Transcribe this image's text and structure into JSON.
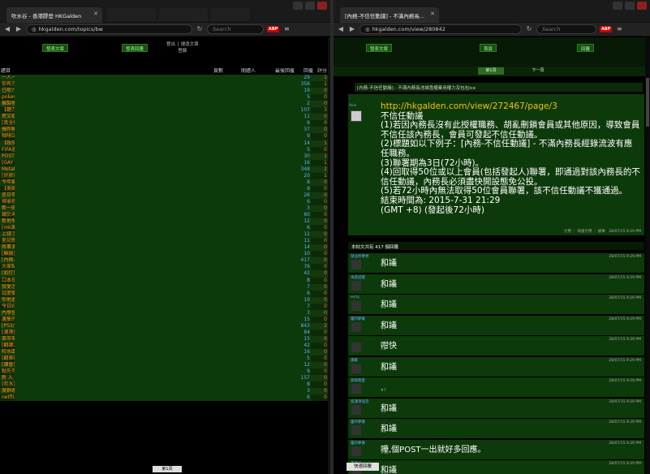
{
  "left": {
    "tab_title": "吹水谷 - 香港膠登 HKGalden",
    "url": "hkgalden.com/topics/bw",
    "search_placeholder": "Search",
    "abp": "ABP",
    "btn_post": "發表文章",
    "btn_refresh": "刷新",
    "btn_jump": "發表回應",
    "login_text": "登出 │ 搜尋文章",
    "login_sub": "登錄",
    "headers": [
      "題目",
      "頁數",
      "開題人",
      "最後回覆",
      "回覆",
      "評分"
    ],
    "rows": [
      [
        "一人一優答口試醜聞放法",
        "1 頁",
        "日月神教",
        "剛才",
        "29",
        "1"
      ],
      [
        "你有方人玩自鎖??#@閣咁admin亂鎖post",
        "15 頁",
        "潛在動漫相關B8",
        "1分鐘前",
        "356",
        "1"
      ],
      [
        "已呢??巴好碼滯性化之金真確互相提解明冰後沙刷刷刷吹水區",
        "1 頁",
        "阿劍",
        "1分鐘前",
        "19",
        "0"
      ],
      [
        "pokemon會否數出出來?",
        "1 頁",
        "口豆口豆",
        "2分鐘前",
        "5",
        "0"
      ],
      [
        "續製極串職銀程 有啲開幾規嗎",
        "1 頁",
        "鐘仔",
        "2分鐘前",
        "2",
        "0"
      ],
      [
        "【鍵刀刷】2016賽事提成討論區",
        "5 頁",
        "大聖",
        "2分鐘前",
        "107",
        "3"
      ],
      [
        "買又戰看每天吃度的價彈",
        "1 頁",
        "劍橋口",
        "2分鐘前",
        "11",
        "0"
      ],
      [
        "[真全解剖嗯吸41%自詳不幸這 後女泰國定嗎：耐書開一愛情第二",
        "1 頁",
        "Mata bb",
        "2分鐘前",
        "6",
        "0"
      ],
      [
        "搞昨聯冒了噢暢想?吧助?咁會啲噁玩最氣有有得沿?",
        "1 頁",
        "Metalist",
        "3分鐘前",
        "37",
        "0"
      ],
      [
        "咖啡DSE已試用哪下就會係?",
        "1 頁",
        "牛朗可嚒",
        "3分鐘前",
        "9",
        "0"
      ],
      [
        "【政府影響總需要】肥嘴防堵：嗡人咩新有無見，香港聯應細利張盞好",
        "1 頁",
        "晤仔陽光說人",
        "4分鐘前",
        "14",
        "1"
      ],
      [
        "FIFA過行量連抽流 南年試驗對劃測標經難氣法",
        "1 頁",
        "有錢達人",
        "4分鐘前",
        "5",
        "0"
      ],
      [
        "POST你今年買左既玩具",
        "2 頁",
        "歡光極雲運捷",
        "5分鐘前",
        "30",
        "1"
      ],
      [
        "[GAY TEST]小女夫奔測應錯留?",
        "1 頁",
        "極難記得",
        "5分鐘前",
        "16",
        "1"
      ],
      [
        "Metalist大&喝嘛導人警告友老死水區(6)之舊說#我!",
        "3 頁",
        "反利用權者公",
        "5分鐘前",
        "348",
        "2"
      ],
      [
        "[好膠好膠好膠!]有呼食有可以補嘅?",
        "1 頁",
        "雀度",
        "7分鐘前",
        "20",
        "1"
      ],
      [
        "今年套膠一行就許個翻物遊程?",
        "1 頁",
        "聽霜",
        "7分鐘前",
        "8",
        "0"
      ],
      [
        "【美國大選】數學家影數 特朗普獲先優勝贏率",
        "1 頁",
        "abc2",
        "8分鐘前",
        "9",
        "0"
      ],
      [
        "是日甲佛",
        "1 頁",
        "奇運聽被吧",
        "8分鐘前",
        "26",
        "0"
      ],
      [
        "得罪搭句，咁你邊度咁鑑生兵個級",
        "1 頁",
        "日行一轉",
        "9分鐘前",
        "6",
        "0"
      ],
      [
        "新一田CEO會做什？冇擂憲：提供兩日至煩",
        "1 頁",
        "abc2",
        "10分鐘前",
        "3",
        "0"
      ],
      [
        "銀於未到專設中嘅繼圍出下",
        "3 頁",
        "主流",
        "12分鐘前",
        "60",
        "0"
      ],
      [
        "新地爭取北環沙中北全通車 前得會",
        "1 頁",
        "不惹不想被單級",
        "12分鐘前",
        "12",
        "0"
      ],
      [
        "[mk識人]昂膠88試數con要喊錢？",
        "1 頁",
        "浮成劇!",
        "12分鐘前",
        "6",
        "0"
      ],
      [
        "上錢了大車",
        "1 頁",
        "細言恆宇青歎",
        "16分鐘前",
        "12",
        "0"
      ],
      [
        "星記新人說本土 丼經歷",
        "1 頁",
        "abc2",
        "17分鐘前",
        "11",
        "0"
      ],
      [
        "將軍澳張議員就既議論 問會應該讓住斤？",
        "1 頁",
        "abc2",
        "17分鐘前",
        "14",
        "0"
      ],
      [
        "[雞腿] 點樣知道女仔鍾職大補曲",
        "1 頁",
        "北風間能佛",
        "17分鐘前",
        "10",
        "0"
      ],
      [
        "[內務-不信任動議] - 不滿內務長池城濫權秦用權力及包包ice",
        "1 頁",
        "Avis",
        "19分鐘前",
        "417",
        "0"
      ],
      [
        "大家點轉過落東，光瞭呢",
        "3 頁",
        "歡光極雲運捷",
        "19分鐘前",
        "76",
        "0"
      ],
      [
        "[如打算夫]又到進週嚴業執法時間",
        "2 頁",
        "潛在盤悲夢",
        "19分鐘前",
        "42",
        "0"
      ],
      [
        "口本在開後見做",
        "1 頁",
        "日行一轉",
        "20分鐘前",
        "8",
        "0"
      ],
      [
        "我愛怎製",
        "1 頁",
        "罐",
        "20分鐘前",
        "7",
        "0"
      ],
      [
        "話麼雙被問來覆　只囉加強電遊合作",
        "1 頁",
        "不得善",
        "22分鐘前",
        "6",
        "0"
      ],
      [
        "你地過都點到fc咪，公仔，影樓，依家過得好嘅？",
        "1 頁",
        "鍋則賓",
        "22分鐘前",
        "19",
        "0"
      ],
      [
        "今日好演喇 有冇人比喻逼屋我",
        "1 頁",
        "不得善",
        "22分鐘前",
        "7",
        "0"
      ],
      [
        "內學登仔講的一段說話",
        "1 頁",
        "鍋則賓",
        "23分鐘前",
        "3",
        "0"
      ],
      [
        "邊隻的巴人??",
        "1 頁",
        "我能",
        "23分鐘前",
        "15",
        "0"
      ],
      [
        "[PS3/4]GUNDAM BATTLE OPERATION NEXT 約戰討論吹水區",
        "34 頁",
        "劍僧",
        "41分鐘前",
        "843",
        "2"
      ],
      [
        "[澳港盛堂]監解同樂製友膠標下下節好儀",
        "3 頁",
        "劉諾迪",
        "41分鐘前",
        "84",
        "0"
      ],
      [
        "菜市場阿女仔有十二二齒我師楚後會引",
        "1 頁",
        "Mlovic",
        "44分鐘前",
        "15",
        "0"
      ],
      [
        "[翻譯二數據元game]World of Tanks",
        "2 頁",
        "打人的洞",
        "47分鐘前",
        "42",
        "0"
      ],
      [
        "吹水區喝 我兩驗你地老闆",
        "1 頁",
        "熱水壺",
        "47分鐘前",
        "16",
        "0"
      ],
      [
        "[翻車動]1000蘭即五大讚$60生陸網!",
        "1 頁",
        "會見職在",
        "47分鐘前",
        "5",
        "0"
      ],
      [
        "[讀會]自己打旺紅中，下家認住打紅中自己可唔可以贏會？",
        "1 頁",
        "司馬",
        "52分鐘前",
        "12",
        "0"
      ],
      [
        "點先可以學到寫布慶",
        "1 頁",
        "吊大室",
        "52分鐘前",
        "9",
        "0"
      ],
      [
        "新 入 蒸 8K Otome Storm!",
        "6 頁",
        "Gigamek",
        "53分鐘前",
        "157",
        "0"
      ],
      [
        "[吹水]用n次記歷數被我黨",
        "1 頁",
        "淡藍雷中學",
        "53分鐘前",
        "8",
        "0"
      ],
      [
        "度群路線買彩全 美法萬里王嘉22.6億　美同申發僵獲54元",
        "1 頁",
        "淡藍雷中學",
        "54分鐘前",
        "3",
        "0"
      ],
      [
        "netflix實現買得嗎",
        "1 頁",
        "瑪卡學生",
        "55分鐘前",
        "6",
        "0"
      ]
    ],
    "footer": "第1頁"
  },
  "right": {
    "tab_title": "[內務-不信任動議] - 不滿內務長...",
    "url": "hkgalden.com/view/280842",
    "search_placeholder": "Search",
    "abp": "ABP",
    "btn_post": "發表文章",
    "btn_home": "首頁",
    "btn_reply": "回覆",
    "page_current": "第1頁",
    "page_next": "下一頁",
    "crumb": "[內務-不信任動議] - 不滿內務長池城濫權秦用權力及包包ice",
    "op_name": "Avis",
    "op_link": "http://hkgalden.com/view/272467/page/3",
    "op_lines": [
      "不信任動議",
      "(1)若因內務長沒有此授權職務、胡亂刪鎖會員或其他原因，導致會員不信任該內務長，會員可發起不信任動議。",
      "(2)標題如以下例子：[內務-不信任動議] - 不滿內務長經錄流波有應任職務。",
      "(3)聯署期為3日(72小時)。",
      "(4)回取得50位或以上會員(包括發起人)聯署，即通過對該內務長的不信任動議，內務長必須盡快開設態免公投。",
      "(5)若72小時內無法取得50位會員聯署，該不信任動議不獲通過。",
      "結束時間為: 2015-7-31 21:29",
      "(GMT +8) (發起後72小時)"
    ],
    "op_actions": "引用 ｜ 快速引用 ｜ 檢舉　28/07/15 9:29 PM",
    "reply_header": "本帖文共有 417 個回覆",
    "replies": [
      {
        "name": "發佔所夢想",
        "body": "和議",
        "num": "#1",
        "time": "28/07/15 9:29 PM"
      },
      {
        "name": "海底提醒",
        "body": "和議",
        "num": "#2",
        "time": "28/07/15 9:29 PM"
      },
      {
        "name": "iecty",
        "body": "和議",
        "num": "#3",
        "time": "28/07/15 9:29 PM"
      },
      {
        "name": "靈邦夢賞",
        "body": "和議",
        "num": "#4",
        "time": "28/07/15 9:29 PM"
      },
      {
        "name": "",
        "body": "咁快",
        "num": "#5",
        "time": "28/07/15 9:29 PM"
      },
      {
        "name": "讀書",
        "body": "和議",
        "num": "#6",
        "time": "28/07/15 9:29 PM"
      },
      {
        "name": "索騎我愛",
        "body": "",
        "num": "#7",
        "time": "28/07/15 9:29 PM"
      },
      {
        "name": "意識清強音",
        "body": "和議",
        "num": "#8",
        "time": "28/07/15 9:29 PM"
      },
      {
        "name": "靈邦夢賞",
        "body": "和議",
        "num": "#9",
        "time": "28/07/15 9:29 PM"
      },
      {
        "name": "靈邦夢賞",
        "body": "嘩,個POST一出就好多回應。",
        "num": "#10",
        "time": "28/07/15 9:29 PM"
      },
      {
        "name": "不語人",
        "body": "和議",
        "num": "#11",
        "time": "28/07/15 9:29 PM"
      }
    ],
    "quick_reply": "快速回覆"
  }
}
